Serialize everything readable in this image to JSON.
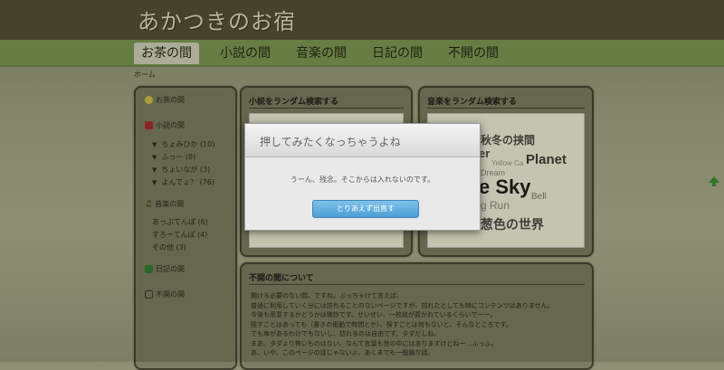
{
  "site": {
    "title": "あかつきのお宿"
  },
  "nav": [
    {
      "label": "お茶の間"
    },
    {
      "label": "小説の間"
    },
    {
      "label": "音楽の間"
    },
    {
      "label": "日記の間"
    },
    {
      "label": "不開の間"
    }
  ],
  "breadcrumb": "ホーム",
  "sidebar": {
    "items": [
      {
        "label": "お茶の間",
        "icon": "teacup-icon",
        "color": "#d8c84a"
      },
      {
        "label": "小説の間",
        "icon": "book-icon",
        "color": "#b02020"
      },
      {
        "label": "ちょみひか (10)"
      },
      {
        "label": "ふっー (8)"
      },
      {
        "label": "ちょいなが (3)"
      },
      {
        "label": "よんでょ？ (76)"
      },
      {
        "label": "音楽の間",
        "icon": "music-note-icon",
        "color": "#222222"
      },
      {
        "label": "あっぷてんぽ (6)"
      },
      {
        "label": "すろーてんぽ (4)"
      },
      {
        "label": "その他 (3)"
      },
      {
        "label": "日記の間",
        "icon": "diary-icon",
        "color": "#2d7a2d"
      },
      {
        "label": "不開の間",
        "icon": "lock-icon",
        "color": "#333333"
      }
    ]
  },
  "novel_card": {
    "title": "小説をランダム検索する"
  },
  "music_card": {
    "title": "音楽をランダム検索する",
    "cloud": [
      "秋冬の挟間",
      "er",
      "Planet",
      "Yellow Ca",
      "Dream",
      "e Sky",
      "Bell",
      "g Run",
      "葱色の世界"
    ]
  },
  "about_card": {
    "title": "不開の間について",
    "lines": [
      "開ける必要のない間、ですね。ぶっちゃけて言えば、",
      "普通に利用していく分には訪れることのないページですが、訪れたとしても特にコンテンツはありません。",
      "今後も用意するかどうかは微妙です。せいぜい、一枚絵が置かれているくらいで一ー。",
      "隠すことはあっても（書きの衝動で時間とか）、探すことは何もないと、そんなところです。",
      "でも扉があるわけでもないし、訪れるのは自由です。タダだしね。",
      "まあ、タダより怖いものはない、なんて言葉も世の中にはありますけどねー…ふっふ。",
      "あ、いや、このページの話じゃないよ、あくまでも一般論な話。"
    ]
  },
  "dialog": {
    "title": "押してみたくなっちゃうよね",
    "message": "うーん、残念。そこからは入れないのです。",
    "button": "とりあえず出直す"
  },
  "colors": {
    "header": "#4e4a33",
    "nav": "#7c9a53",
    "panel": "#7b7c63",
    "dialog_button": "#4c9ed4"
  }
}
